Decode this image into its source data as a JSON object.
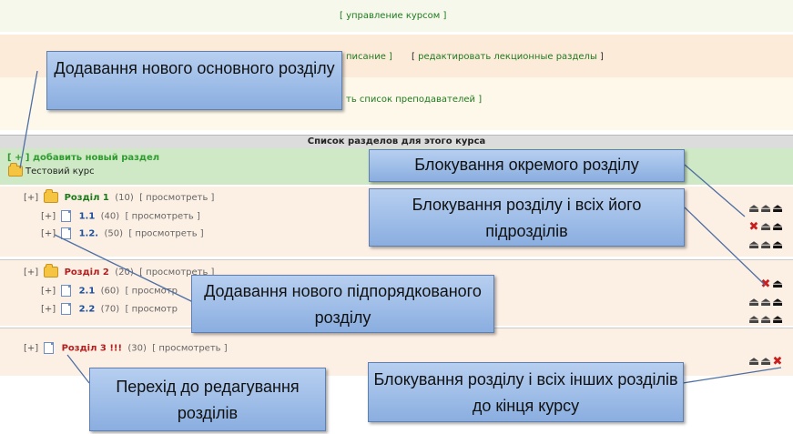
{
  "top": {
    "manage_course": "[ управление курсом ]",
    "bracket_open": "[",
    "bracket_close": "]",
    "schedule_tail": "писание ]",
    "edit_lecture_sections": "редактировать лекционные разделы",
    "teachers_tail": "ть список преподавателей ]"
  },
  "list_header": "Список разделов для этого курса",
  "add_section": "[ + ]  добавить новый раздел",
  "course_name": "Тестовий курс",
  "sections": [
    {
      "plus": "[+]",
      "name": "Розділ 1",
      "count": "(10)",
      "view": "[ просмотреть ]",
      "subs": [
        {
          "plus": "[+]",
          "num": "1.1",
          "count": "(40)",
          "view": "[ просмотреть ]"
        },
        {
          "plus": "[+]",
          "num": "1.2.",
          "count": "(50)",
          "view": "[ просмотреть ]"
        }
      ]
    },
    {
      "plus": "[+]",
      "name": "Розділ 2",
      "count": "(20)",
      "view": "[ просмотреть ]",
      "subs": [
        {
          "plus": "[+]",
          "num": "2.1",
          "count": "(60)",
          "view": "[ просмотр"
        },
        {
          "plus": "[+]",
          "num": "2.2",
          "count": "(70)",
          "view": "[ просмотр"
        }
      ]
    },
    {
      "plus": "[+]",
      "name": "Розділ 3 !!!",
      "count": "(30)",
      "view": "[ просмотреть ]",
      "subs": []
    }
  ],
  "lock_glyph": "⏏",
  "callouts": {
    "add_main": "Додавання нового основного розділу",
    "block_single": "Блокування окремого розділу",
    "block_with_subs": "Блокування розділу і всіх його підрозділів",
    "add_sub": "Додавання нового підпорядкованого розділу",
    "go_edit": "Перехід до редагування розділів",
    "block_to_end": "Блокування розділу і всіх інших розділів до кінця курсу"
  },
  "colors": {
    "green_band": "#cfe9c6",
    "section_band": "#fcefe4",
    "callout_fill": "#9fbde8",
    "link_green": "#1f7a1f",
    "section_red": "#b21f1f"
  }
}
